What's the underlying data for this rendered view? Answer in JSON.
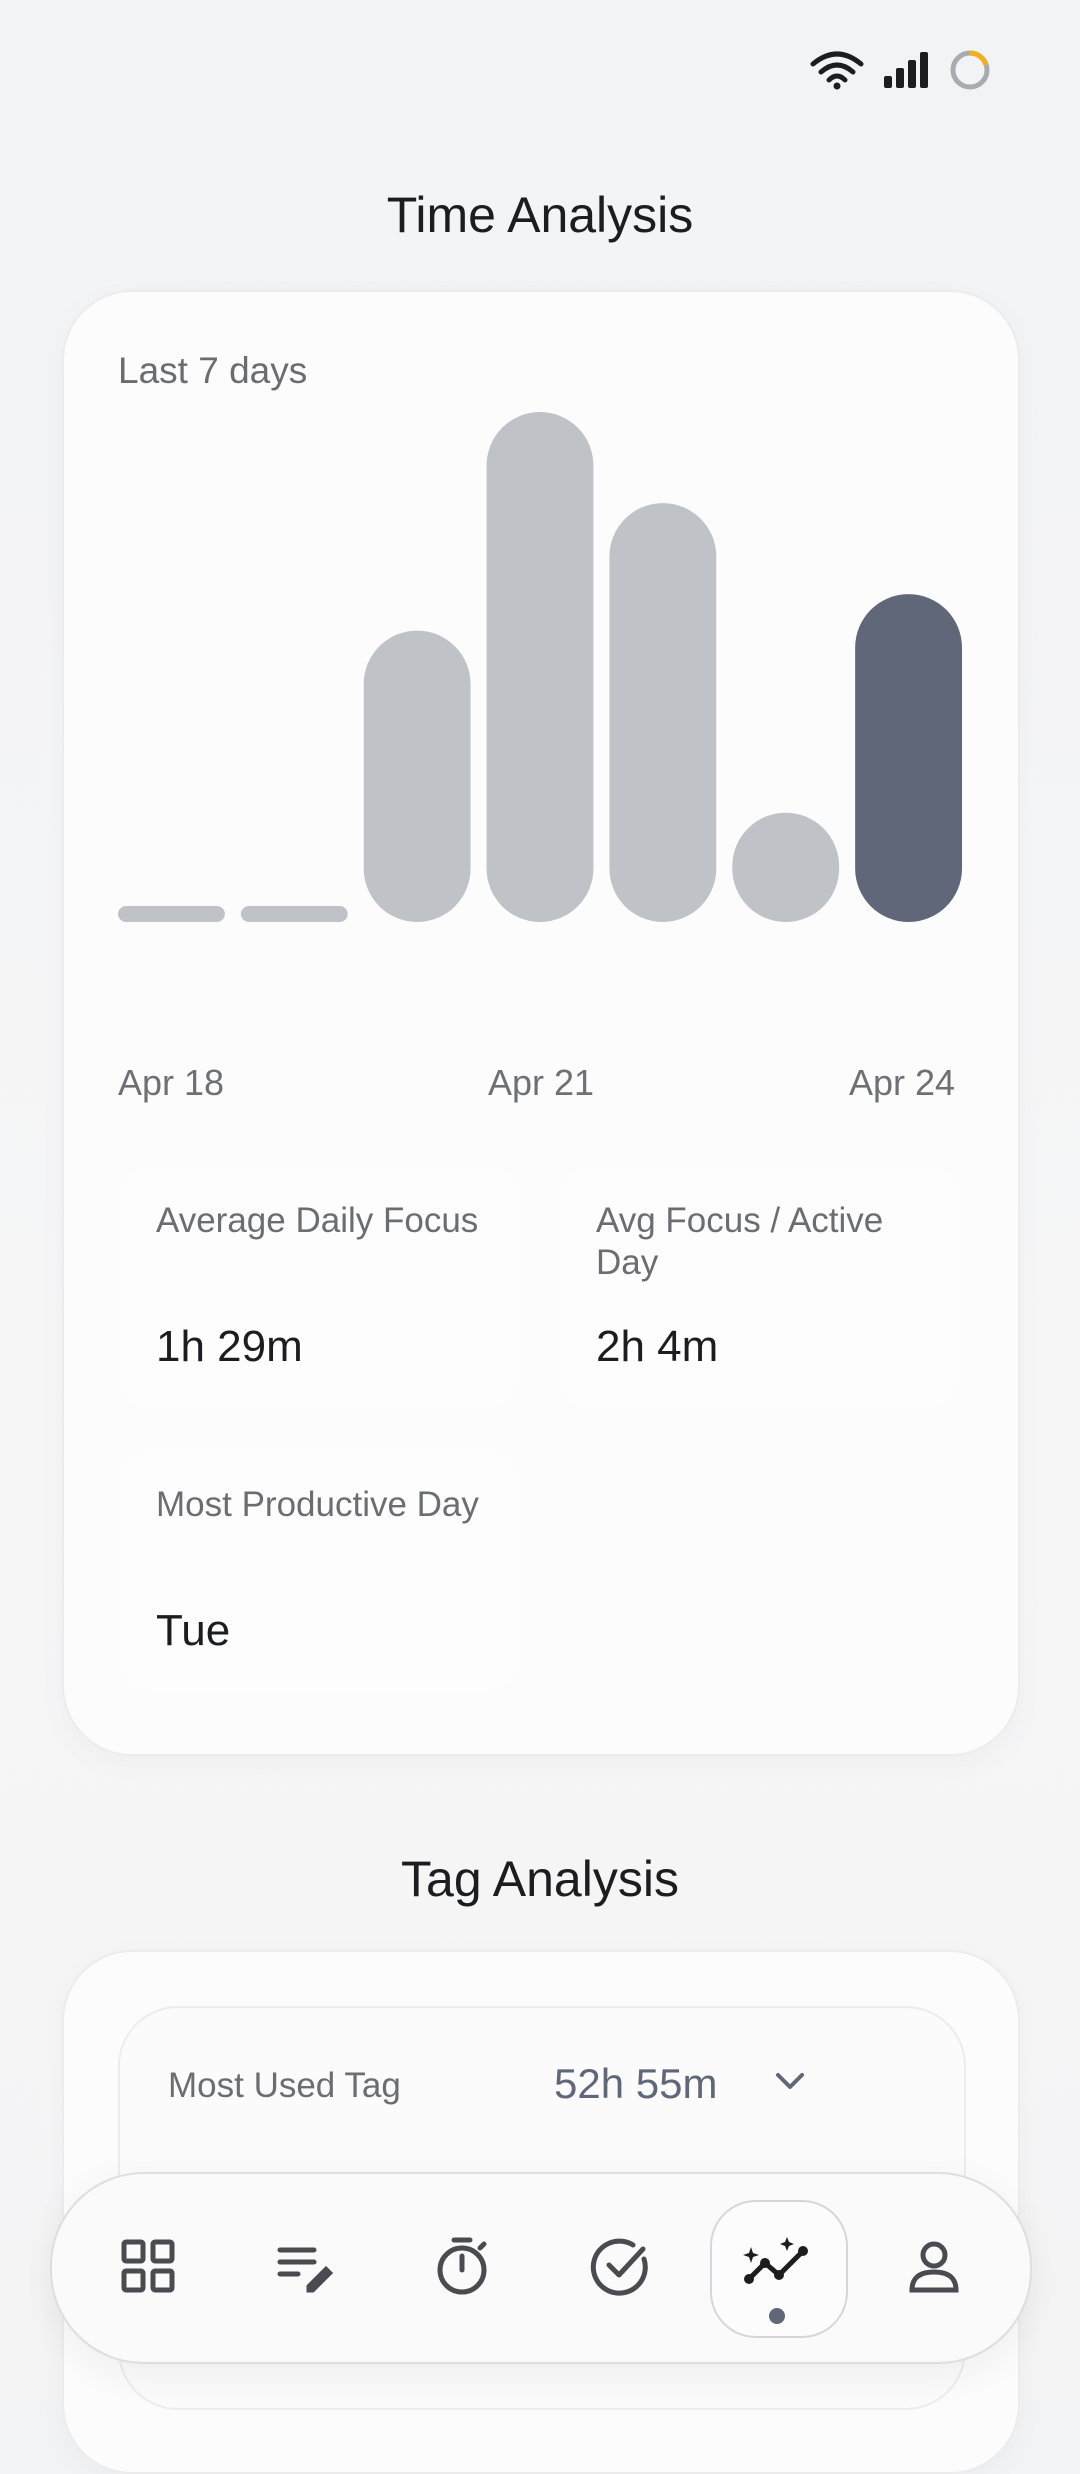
{
  "time_analysis": {
    "title": "Time Analysis",
    "range_label": "Last 7 days",
    "x_tick_labels": [
      "Apr 18",
      "Apr 21",
      "Apr 24"
    ]
  },
  "chart_data": {
    "type": "bar",
    "categories": [
      "Apr 18",
      "Apr 19",
      "Apr 20",
      "Apr 21",
      "Apr 22",
      "Apr 23",
      "Apr 24"
    ],
    "values": [
      0,
      0,
      1.6,
      2.8,
      2.3,
      0.6,
      1.8
    ],
    "ylim": [
      0,
      2.8
    ],
    "highlight_index": 6,
    "bar_color": "#bfc3c8",
    "highlight_color": "#5f6778",
    "grid": false,
    "legend": "none"
  },
  "stats": {
    "avg_daily_label": "Average Daily Focus",
    "avg_daily_value": "1h 29m",
    "avg_active_label": "Avg Focus / Active Day",
    "avg_active_value": "2h 4m",
    "productive_label": "Most Productive Day",
    "productive_value": "Tue"
  },
  "tag_analysis": {
    "title": "Tag Analysis",
    "most_used_label": "Most Used Tag",
    "most_used_time": "52h 55m"
  },
  "nav": {
    "items": [
      "dashboard-icon",
      "notes-edit-icon",
      "timer-icon",
      "check-circle-icon",
      "analytics-icon",
      "profile-icon"
    ],
    "active_index": 4,
    "accent": "#5f6778"
  }
}
